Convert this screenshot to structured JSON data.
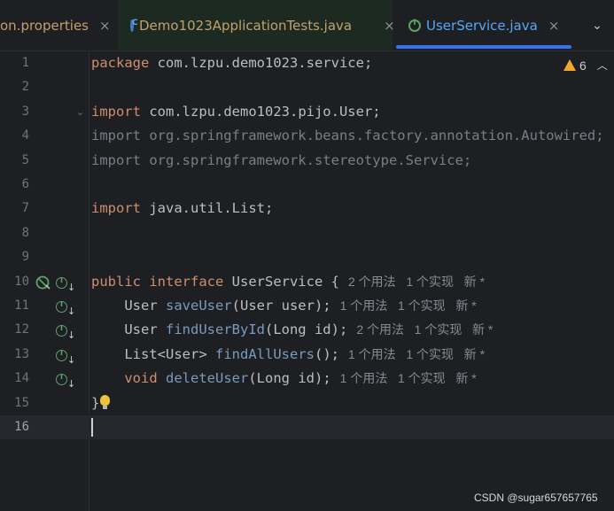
{
  "tabs": [
    {
      "label": "on.properties",
      "close": "×"
    },
    {
      "label": "Demo1023ApplicationTests.java",
      "close": "×"
    },
    {
      "label": "UserService.java",
      "close": "×",
      "active": true
    }
  ],
  "tab_menu_icon": "chevron-down-icon",
  "warnings": {
    "count": "6"
  },
  "editor": {
    "lines": [
      {
        "n": "1",
        "parts": [
          [
            "kw",
            "package"
          ],
          [
            "",
            "com.lzpu.demo1023.service;"
          ]
        ]
      },
      {
        "n": "2",
        "parts": []
      },
      {
        "n": "3",
        "parts": [
          [
            "kw",
            "import"
          ],
          [
            "",
            "com.lzpu.demo1023.pijo.User;"
          ]
        ]
      },
      {
        "n": "4",
        "parts": [
          [
            "muted",
            "import org.springframework.beans.factory.annotation.Autowired;"
          ]
        ]
      },
      {
        "n": "5",
        "parts": [
          [
            "muted",
            "import org.springframework.stereotype.Service;"
          ]
        ]
      },
      {
        "n": "6",
        "parts": []
      },
      {
        "n": "7",
        "parts": [
          [
            "kw",
            "import"
          ],
          [
            "",
            "java.util.List;"
          ]
        ]
      },
      {
        "n": "8",
        "parts": []
      },
      {
        "n": "9",
        "parts": []
      },
      {
        "n": "10",
        "parts": [
          [
            "kw",
            "public interface"
          ],
          [
            "",
            "UserService {"
          ]
        ],
        "hint": "2 个用法   1 个实现   新 *"
      },
      {
        "n": "11",
        "parts": [
          [
            "",
            "    User"
          ],
          [
            "fnm",
            "saveUser"
          ],
          [
            "",
            "(User user);"
          ]
        ],
        "hint": "1 个用法   1 个实现   新 *"
      },
      {
        "n": "12",
        "parts": [
          [
            "",
            "    User"
          ],
          [
            "fnm",
            "findUserById"
          ],
          [
            "",
            "(Long id);"
          ]
        ],
        "hint": "2 个用法   1 个实现   新 *"
      },
      {
        "n": "13",
        "parts": [
          [
            "",
            "    List<User>"
          ],
          [
            "fnm",
            "findAllUsers"
          ],
          [
            "",
            "();"
          ]
        ],
        "hint": "1 个用法   1 个实现   新 *"
      },
      {
        "n": "14",
        "parts": [
          [
            "kw",
            "    void"
          ],
          [
            "fnm",
            "deleteUser"
          ],
          [
            "",
            "(Long id);"
          ]
        ],
        "hint": "1 个用法   1 个实现   新 *"
      },
      {
        "n": "15",
        "parts": [
          [
            "",
            "}"
          ]
        ]
      },
      {
        "n": "16",
        "parts": [],
        "current": true
      }
    ]
  },
  "watermark": "CSDN @sugar657657765",
  "colors": {
    "accent": "#3574f0",
    "keyword": "#cf8e6d",
    "method": "#7a9bbd",
    "background": "#1e1f22"
  }
}
